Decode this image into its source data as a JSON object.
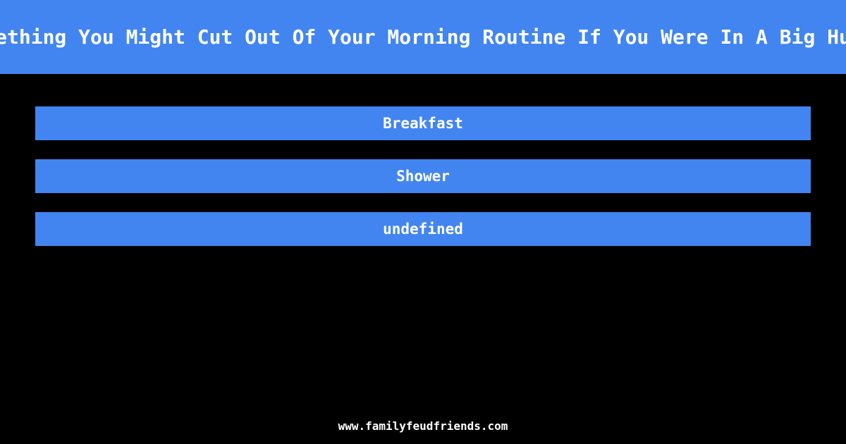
{
  "theme": {
    "background_color": "#000000",
    "accent_color": "#4285f1",
    "text_color": "#ffffff"
  },
  "header": {
    "title": "Something You Might Cut Out Of Your Morning Routine If You Were In A Big Hurry",
    "visible_title_clipped": "Something You Might Cut Out Of Your Morning Routine If You Were In A Big H"
  },
  "answers": [
    {
      "rank": 1,
      "text": "Breakfast"
    },
    {
      "rank": 2,
      "text": "Shower"
    },
    {
      "rank": 3,
      "text": "undefined"
    }
  ],
  "footer": {
    "site_url": "www.familyfeudfriends.com"
  }
}
